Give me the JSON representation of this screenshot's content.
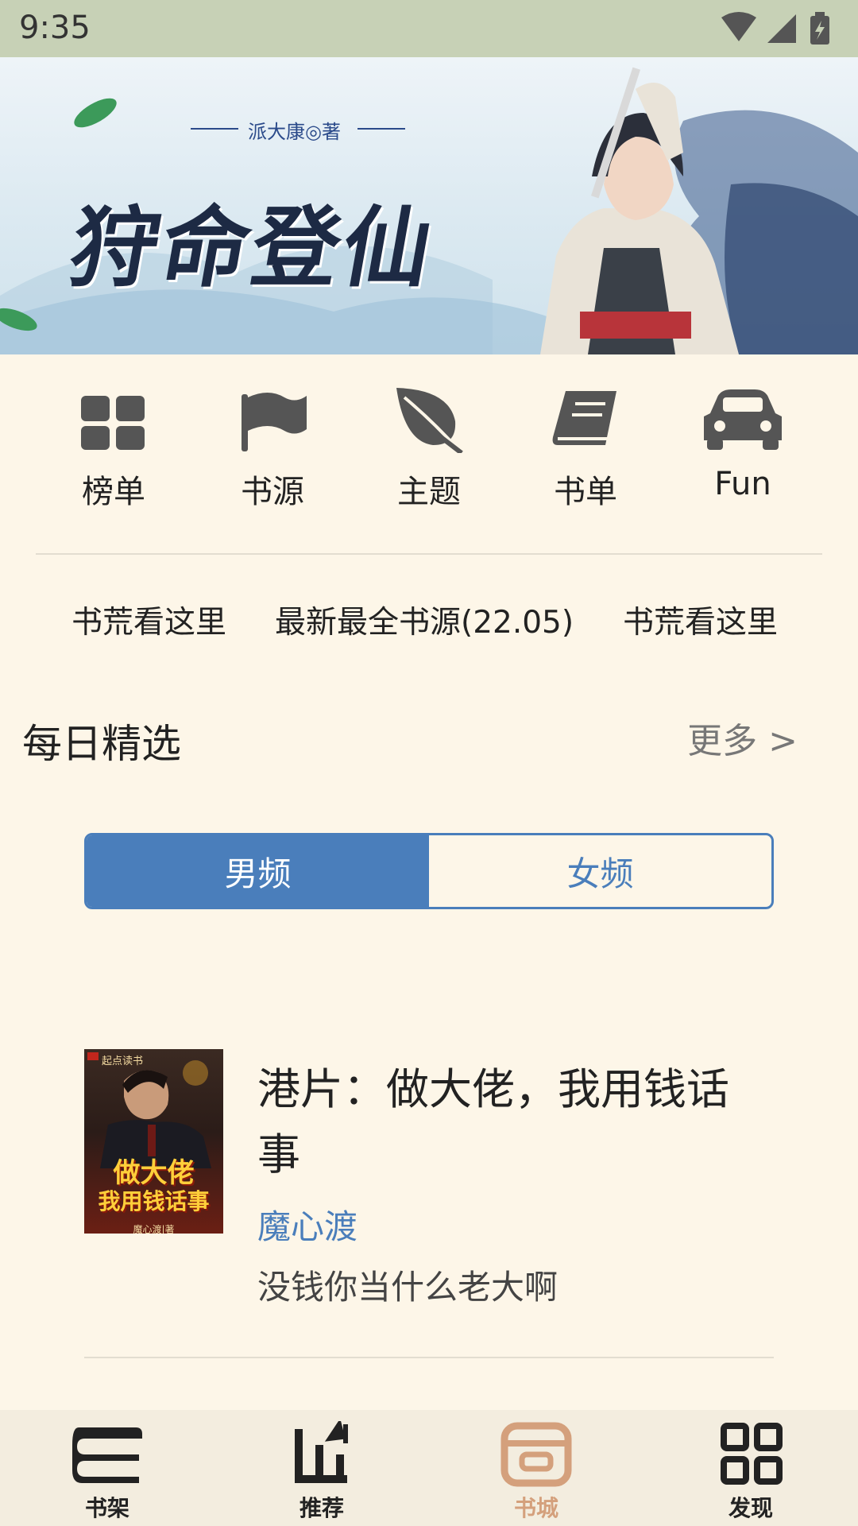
{
  "status_bar": {
    "time": "9:35"
  },
  "banner": {
    "author_line": "派大康◎著",
    "title": "狩命登仙"
  },
  "quick_nav": [
    {
      "label": "榜单",
      "icon": "grid-icon"
    },
    {
      "label": "书源",
      "icon": "flag-icon"
    },
    {
      "label": "主题",
      "icon": "leaf-icon"
    },
    {
      "label": "书单",
      "icon": "book-icon"
    },
    {
      "label": "Fun",
      "icon": "car-icon"
    }
  ],
  "source_links": [
    "书荒看这里",
    "最新最全书源(22.05)",
    "书荒看这里"
  ],
  "daily": {
    "title": "每日精选",
    "more": "更多 >"
  },
  "gender_tabs": {
    "male": "男频",
    "female": "女频",
    "selected": "男频"
  },
  "book": {
    "title": "港片：做大佬，我用钱话事",
    "author": "魔心渡",
    "description": "没钱你当什么老大啊",
    "cover": {
      "brand": "起点读书",
      "title_line1": "做大佬",
      "title_line2": "我用钱话事",
      "author": "魔心渡|著"
    }
  },
  "bottom_nav": [
    {
      "label": "书架",
      "icon": "bookshelf-icon"
    },
    {
      "label": "推荐",
      "icon": "recommend-icon"
    },
    {
      "label": "书城",
      "icon": "store-icon",
      "active": true
    },
    {
      "label": "发现",
      "icon": "discover-icon"
    }
  ],
  "colors": {
    "accent": "#4a7ebb",
    "active_nav": "#d4a07c",
    "background": "#fdf6e8",
    "status_bar": "#c7d1b6"
  }
}
